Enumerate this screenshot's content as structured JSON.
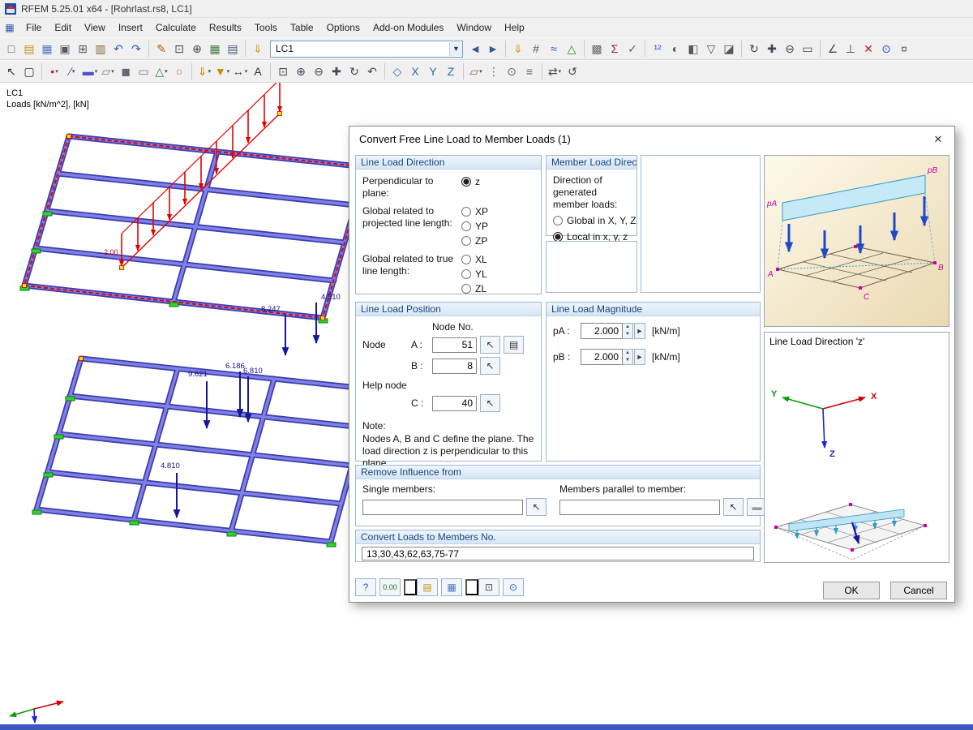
{
  "titlebar": {
    "title": "RFEM 5.25.01 x64 - [Rohrlast.rs8, LC1]"
  },
  "menu": {
    "items": [
      {
        "name": "menu-file",
        "label": "File"
      },
      {
        "name": "menu-edit",
        "label": "Edit"
      },
      {
        "name": "menu-view",
        "label": "View"
      },
      {
        "name": "menu-insert",
        "label": "Insert"
      },
      {
        "name": "menu-calculate",
        "label": "Calculate"
      },
      {
        "name": "menu-results",
        "label": "Results"
      },
      {
        "name": "menu-tools",
        "label": "Tools"
      },
      {
        "name": "menu-table",
        "label": "Table"
      },
      {
        "name": "menu-options",
        "label": "Options"
      },
      {
        "name": "menu-addon-modules",
        "label": "Add-on Modules"
      },
      {
        "name": "menu-window",
        "label": "Window"
      },
      {
        "name": "menu-help",
        "label": "Help"
      }
    ]
  },
  "toolbar1": {
    "load_case": "LC1",
    "left": [
      {
        "name": "new-file-icon",
        "glyph": "□",
        "color": "#555"
      },
      {
        "name": "open-folder-icon",
        "glyph": "▤",
        "color": "#c79018"
      },
      {
        "name": "save-icon",
        "glyph": "▦",
        "color": "#4f74c0"
      },
      {
        "name": "print-icon",
        "glyph": "▣",
        "color": "#556"
      },
      {
        "name": "copy-icon",
        "glyph": "⊞",
        "color": "#556"
      },
      {
        "name": "report-icon",
        "glyph": "▥",
        "color": "#845f2f"
      },
      {
        "name": "undo-icon",
        "glyph": "↶",
        "color": "#2a5db0"
      },
      {
        "name": "redo-icon",
        "glyph": "↷",
        "color": "#2a5db0"
      },
      {
        "sep": true
      },
      {
        "name": "sketch-pen-icon",
        "glyph": "✎",
        "color": "#b05a00"
      },
      {
        "name": "zoom-region-icon",
        "glyph": "⊡",
        "color": "#445"
      },
      {
        "name": "zoom-in-icon",
        "glyph": "⊕",
        "color": "#445"
      },
      {
        "name": "tables-icon",
        "glyph": "▦",
        "color": "#3f7d3f"
      },
      {
        "name": "printout-report-icon",
        "glyph": "▤",
        "color": "#44557f"
      },
      {
        "sep": true
      },
      {
        "name": "load-case-icon",
        "glyph": "⇓",
        "color": "#d49a00"
      }
    ],
    "right": [
      {
        "name": "prev-load-case-icon",
        "glyph": "◄",
        "color": "#33579a"
      },
      {
        "name": "next-load-case-icon",
        "glyph": "►",
        "color": "#33579a"
      },
      {
        "sep": true
      },
      {
        "name": "show-loads-icon",
        "glyph": "⇓",
        "color": "#d49a00"
      },
      {
        "name": "show-load-values-icon",
        "glyph": "#",
        "color": "#555"
      },
      {
        "name": "show-results-icon",
        "glyph": "≈",
        "color": "#2255cc"
      },
      {
        "name": "show-supports-icon",
        "glyph": "△",
        "color": "#2a8a2a"
      },
      {
        "sep": true
      },
      {
        "name": "mesh-icon",
        "glyph": "▩",
        "color": "#666"
      },
      {
        "name": "calculate-icon",
        "glyph": "Σ",
        "color": "#8a2a2a"
      },
      {
        "name": "check-icon",
        "glyph": "✓",
        "color": "#2a8a2a"
      },
      {
        "sep": true
      },
      {
        "name": "renumber-icon",
        "glyph": "¹²",
        "color": "#2255cc"
      },
      {
        "name": "visibility-icon",
        "glyph": "◐",
        "color": "#555"
      },
      {
        "name": "partial-view-icon",
        "glyph": "◧",
        "color": "#555"
      },
      {
        "name": "filter-icon",
        "glyph": "▽",
        "color": "#555"
      },
      {
        "name": "clipping-plane-icon",
        "glyph": "◪",
        "color": "#555"
      },
      {
        "sep": true
      },
      {
        "name": "rotate-view-icon",
        "glyph": "↻",
        "color": "#445"
      },
      {
        "name": "move-view-icon",
        "glyph": "✚",
        "color": "#445"
      },
      {
        "name": "zoom-out-icon",
        "glyph": "⊖",
        "color": "#445"
      },
      {
        "name": "full-view-icon",
        "glyph": "▭",
        "color": "#445"
      },
      {
        "sep": true
      },
      {
        "name": "measure-angle-icon",
        "glyph": "∠",
        "color": "#445"
      },
      {
        "name": "perpendicular-icon",
        "glyph": "⊥",
        "color": "#445"
      },
      {
        "name": "delete-loads-icon",
        "glyph": "✕",
        "color": "#c02020"
      },
      {
        "name": "info-icon",
        "glyph": "⊙",
        "color": "#2255cc"
      },
      {
        "name": "options-icon",
        "glyph": "¤",
        "color": "#556"
      }
    ]
  },
  "toolbar2": {
    "icons": [
      {
        "name": "select-pointer-icon",
        "glyph": "↖",
        "color": "#333"
      },
      {
        "name": "select-region-icon",
        "glyph": "▢",
        "color": "#333"
      },
      {
        "sep": true
      },
      {
        "name": "node-tool-icon",
        "glyph": "•",
        "color": "#cc2222",
        "menu": true
      },
      {
        "name": "line-tool-icon",
        "glyph": "∕",
        "color": "#2255cc",
        "menu": true
      },
      {
        "name": "member-tool-icon",
        "glyph": "▬",
        "color": "#5050c8",
        "menu": true
      },
      {
        "name": "surface-tool-icon",
        "glyph": "▱",
        "color": "#777",
        "menu": true
      },
      {
        "name": "solid-tool-icon",
        "glyph": "◼",
        "color": "#667"
      },
      {
        "name": "opening-tool-icon",
        "glyph": "▭",
        "color": "#777"
      },
      {
        "name": "node-support-icon",
        "glyph": "△",
        "color": "#2a8a2a",
        "menu": true
      },
      {
        "name": "member-hinge-icon",
        "glyph": "○",
        "color": "#aa7722"
      },
      {
        "sep": true
      },
      {
        "name": "member-load-icon",
        "glyph": "⇓",
        "color": "#cc8800",
        "menu": true
      },
      {
        "name": "surface-load-icon",
        "glyph": "▼",
        "color": "#cc8800",
        "menu": true
      },
      {
        "name": "dimension-icon",
        "glyph": "↔",
        "color": "#333",
        "menu": true
      },
      {
        "name": "text-comment-icon",
        "glyph": "A",
        "color": "#333"
      },
      {
        "sep": true
      },
      {
        "name": "zoom-window-icon",
        "glyph": "⊡",
        "color": "#445"
      },
      {
        "name": "zoom-in-icon-2",
        "glyph": "⊕",
        "color": "#445"
      },
      {
        "name": "zoom-out-icon-2",
        "glyph": "⊖",
        "color": "#445"
      },
      {
        "name": "pan-view-icon",
        "glyph": "✚",
        "color": "#445"
      },
      {
        "name": "rotate-mode-icon",
        "glyph": "↻",
        "color": "#445"
      },
      {
        "name": "previous-view-icon",
        "glyph": "↶",
        "color": "#445"
      },
      {
        "sep": true
      },
      {
        "name": "isometric-view-icon",
        "glyph": "◇",
        "color": "#3366aa"
      },
      {
        "name": "view-in-x-icon",
        "glyph": "X",
        "color": "#3366aa"
      },
      {
        "name": "view-in-y-icon",
        "glyph": "Y",
        "color": "#3366aa"
      },
      {
        "name": "view-in-z-icon",
        "glyph": "Z",
        "color": "#3366aa"
      },
      {
        "sep": true
      },
      {
        "name": "work-plane-icon",
        "glyph": "▱",
        "color": "#8a6a2a",
        "menu": true
      },
      {
        "name": "grid-snap-icon",
        "glyph": "⋮",
        "color": "#666"
      },
      {
        "name": "object-snap-icon",
        "glyph": "⊙",
        "color": "#666"
      },
      {
        "name": "guidelines-icon",
        "glyph": "≡",
        "color": "#666"
      },
      {
        "sep": true
      },
      {
        "name": "move-copy-icon",
        "glyph": "⇄",
        "color": "#445",
        "menu": true
      },
      {
        "name": "rotate-copy-icon",
        "glyph": "↺",
        "color": "#445"
      }
    ]
  },
  "canvas": {
    "legend_line1": "LC1",
    "legend_line2": "Loads [kN/m^2], [kN]",
    "load_values": [
      "8.247",
      "4.810",
      "9.621",
      "6.186",
      "6.810",
      "4.810"
    ],
    "red_load_value": "2.00"
  },
  "dialog": {
    "title": "Convert Free Line Load to Member Loads   (1)",
    "close_glyph": "✕",
    "line_load_direction": {
      "title": "Line Load Direction",
      "perpendicular_label": "Perpendicular to plane:",
      "projected_label": "Global related to projected line length:",
      "true_label": "Global related to true line length:",
      "selected": "z",
      "radio_z": "z",
      "radio_xp": "XP",
      "radio_yp": "YP",
      "radio_zp": "ZP",
      "radio_xl": "XL",
      "radio_yl": "YL",
      "radio_zl": "ZL"
    },
    "member_load_direction": {
      "title": "Member Load Direction",
      "description": "Direction of generated member loads:",
      "selected": "Local in x, y, z",
      "radio_global": "Global in X, Y, Z",
      "radio_local": "Local in x, y, z"
    },
    "line_load_position": {
      "title": "Line Load Position",
      "node_no_header": "Node No.",
      "node_label": "Node",
      "row_a_label": "A :",
      "row_a_value": "51",
      "row_b_label": "B :",
      "row_b_value": "8",
      "help_node_label": "Help node",
      "row_c_label": "C :",
      "row_c_value": "40",
      "note_title": "Note:",
      "note_text": "Nodes A, B and C define the plane. The load direction z is perpendicular to this plane."
    },
    "line_load_magnitude": {
      "title": "Line Load Magnitude",
      "pa_label": "pA :",
      "pa_value": "2.000",
      "pa_unit": "[kN/m]",
      "pb_label": "pB :",
      "pb_value": "2.000",
      "pb_unit": "[kN/m]"
    },
    "remove_influence": {
      "title": "Remove Influence from",
      "single_label": "Single members:",
      "single_value": "",
      "parallel_label": "Members parallel to member:",
      "parallel_value": ""
    },
    "convert_loads": {
      "title": "Convert Loads to Members No.",
      "value": "13,30,43,62,63,75-77"
    },
    "preview": {
      "pa": "pA",
      "pb": "pB",
      "a": "A",
      "b": "B",
      "c": "C"
    },
    "direction_panel": {
      "title": "Line Load Direction 'z'",
      "x": "X",
      "y": "Y",
      "z": "Z"
    },
    "footer_buttons": [
      {
        "name": "help-button",
        "glyph": "?",
        "color": "#1b5cc8"
      },
      {
        "name": "units-button",
        "glyph": "0.00",
        "color": "#0a7a0a"
      },
      {
        "sep": true
      },
      {
        "name": "open-settings-button",
        "glyph": "▤",
        "color": "#c79018"
      },
      {
        "name": "save-settings-button",
        "glyph": "▦",
        "color": "#4f74c0"
      },
      {
        "sep": true
      },
      {
        "name": "preview-button",
        "glyph": "⊡",
        "color": "#445"
      },
      {
        "name": "eye-button",
        "glyph": "⊙",
        "color": "#1b5cc8"
      }
    ],
    "ok": "OK",
    "cancel": "Cancel"
  }
}
